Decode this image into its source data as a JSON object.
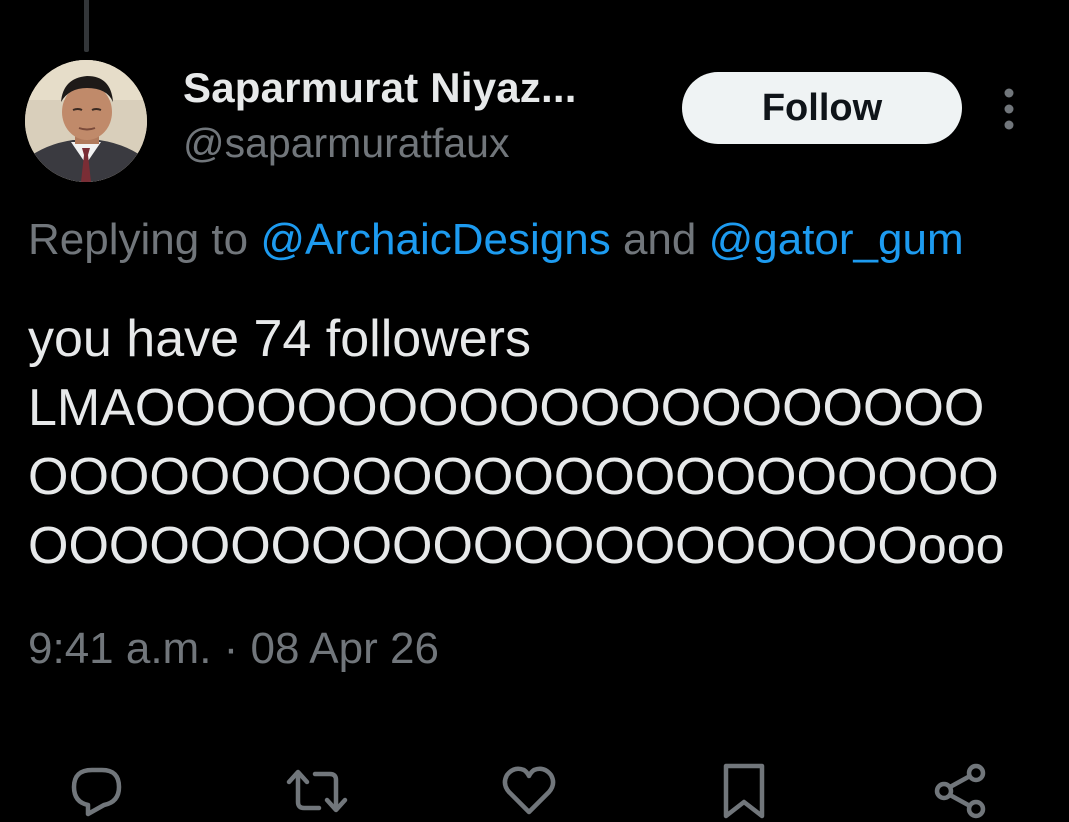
{
  "author": {
    "display_name": "Saparmurat Niyaz...",
    "handle": "@saparmuratfaux"
  },
  "follow_button": {
    "label": "Follow"
  },
  "reply": {
    "prefix": "Replying to ",
    "mention_1": "@ArchaicDesigns",
    "conjunction": " and ",
    "mention_2": "@gator_gum"
  },
  "tweet": {
    "lines": [
      "you have 74 followers",
      "LMAOOOOOOOOOOOOOOOOOOOOO",
      "OOOOOOOOOOOOOOOOOOOOOOOO",
      "OOOOOOOOOOOOOOOOOOOOOOooo"
    ]
  },
  "timestamp": {
    "time": "9:41 a.m.",
    "separator": " · ",
    "date": "08 Apr 26"
  },
  "actions": [
    {
      "name": "reply",
      "icon": "reply-icon"
    },
    {
      "name": "retweet",
      "icon": "retweet-icon"
    },
    {
      "name": "like",
      "icon": "heart-icon"
    },
    {
      "name": "bookmark",
      "icon": "bookmark-icon"
    },
    {
      "name": "share",
      "icon": "share-icon"
    }
  ],
  "colors": {
    "background": "#000000",
    "primary_text": "#e7e9ea",
    "secondary_text": "#71767b",
    "link": "#1d9bf0",
    "follow_button_bg": "#eff3f4",
    "follow_button_text": "#0f1419",
    "thread_line": "#333639"
  }
}
